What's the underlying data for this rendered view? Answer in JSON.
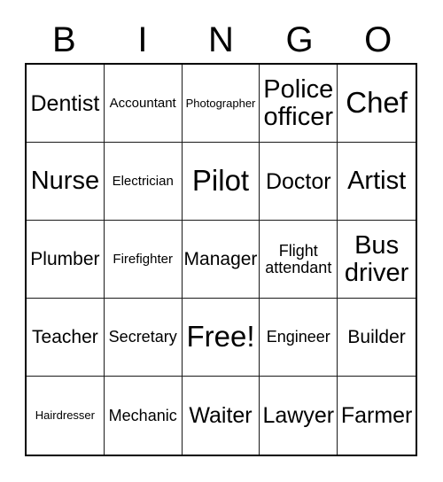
{
  "card": {
    "header_letters": [
      "B",
      "I",
      "N",
      "G",
      "O"
    ],
    "rows": [
      [
        {
          "label": "Dentist",
          "size": "xl"
        },
        {
          "label": "Accountant",
          "size": "s"
        },
        {
          "label": "Photographer",
          "size": "xs"
        },
        {
          "label": "Police\nofficer",
          "size": "xxl"
        },
        {
          "label": "Chef",
          "size": "huge"
        }
      ],
      [
        {
          "label": "Nurse",
          "size": "xxl"
        },
        {
          "label": "Electrician",
          "size": "s"
        },
        {
          "label": "Pilot",
          "size": "huge"
        },
        {
          "label": "Doctor",
          "size": "xl"
        },
        {
          "label": "Artist",
          "size": "xxl"
        }
      ],
      [
        {
          "label": "Plumber",
          "size": "l"
        },
        {
          "label": "Firefighter",
          "size": "s"
        },
        {
          "label": "Manager",
          "size": "l"
        },
        {
          "label": "Flight\nattendant",
          "size": "m"
        },
        {
          "label": "Bus\ndriver",
          "size": "xxl"
        }
      ],
      [
        {
          "label": "Teacher",
          "size": "l"
        },
        {
          "label": "Secretary",
          "size": "m"
        },
        {
          "label": "Free!",
          "size": "huge"
        },
        {
          "label": "Engineer",
          "size": "m"
        },
        {
          "label": "Builder",
          "size": "l"
        }
      ],
      [
        {
          "label": "Hairdresser",
          "size": "xs"
        },
        {
          "label": "Mechanic",
          "size": "m"
        },
        {
          "label": "Waiter",
          "size": "xl"
        },
        {
          "label": "Lawyer",
          "size": "xl"
        },
        {
          "label": "Farmer",
          "size": "xl"
        }
      ]
    ]
  },
  "colors": {
    "background": "#ffffff",
    "text": "#000000",
    "grid_outer_border": "#000000",
    "grid_inner_border": "#1a1a1a"
  }
}
